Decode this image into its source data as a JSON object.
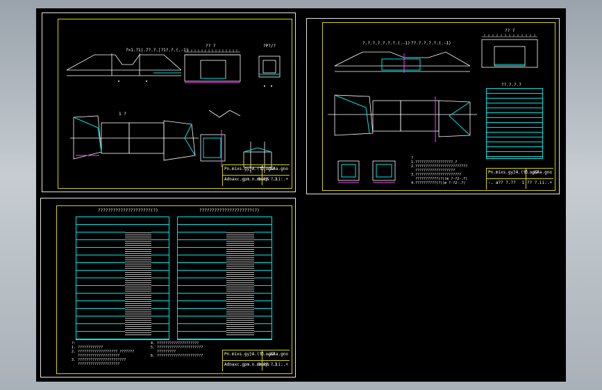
{
  "viewport": {
    "background": "#000000",
    "frame_color": "#d8d400",
    "accent_cyan": "#00e5e5",
    "accent_magenta": "#ff3cff"
  },
  "sheets": {
    "top_left": {
      "title_block": {
        "drawing_name": "Pn.mixs.gy}A.(t) .a2",
        "code": "f.ogS4a.gno",
        "sub_name": "Adnaxc.gpm.n.mmaqs .)",
        "page": "1 ?? ?.ii:.+"
      },
      "labels": {
        "elevation_left": "?>1.?1|.7?.?.|?1?.?.(.-1)",
        "elevation_mid": "?? ?",
        "elevation_right": "?P?/?",
        "plan": "1 ?"
      }
    },
    "top_right": {
      "title_block": {
        "drawing_name": "Pn.mixs.gy}A.(t) .a2",
        "code": "f.ogS4a.gno",
        "sub_name": "-. a?? ?.??",
        "page": "1 ?? ?.ii:.+"
      },
      "labels": {
        "elevation_left": "?.?.?.?.?.?.?.(.-1)",
        "elevation_right": "??.?.?.?.?.(.-1)",
        "section": "?? ?",
        "table_title": "??.?.?.?"
      },
      "notes": "?\n1.??????????????????.?\n2.?????????????????????????\n  ???????????????????\n3.??????????????????????\n  ???????????(?)(m ?-?2-.?)\n4.??????????(?)(m ?-?2-.?)"
    },
    "bottom_left": {
      "title_block": {
        "drawing_name": "Pn.mixs.gy}A.(t) .a2",
        "code": "f.ogS4a.gno",
        "sub_name": "Adnaxc.gpm.n.mmaqs .)",
        "page": "3 ?? ?.ii:.+"
      },
      "table_left_title": "?????????????????????(?)",
      "table_right_title": "?????????????????????(?)",
      "notes_left": "?:\n1. ????????????\n2. ??????????????????? ???????\n   ????????????????????\n3. ???????????????????????\n   ????????????????????",
      "notes_right": "4. ????????????????????\n5. ??????????????????????\n   ?????????\n6. ??????????????????????"
    }
  }
}
